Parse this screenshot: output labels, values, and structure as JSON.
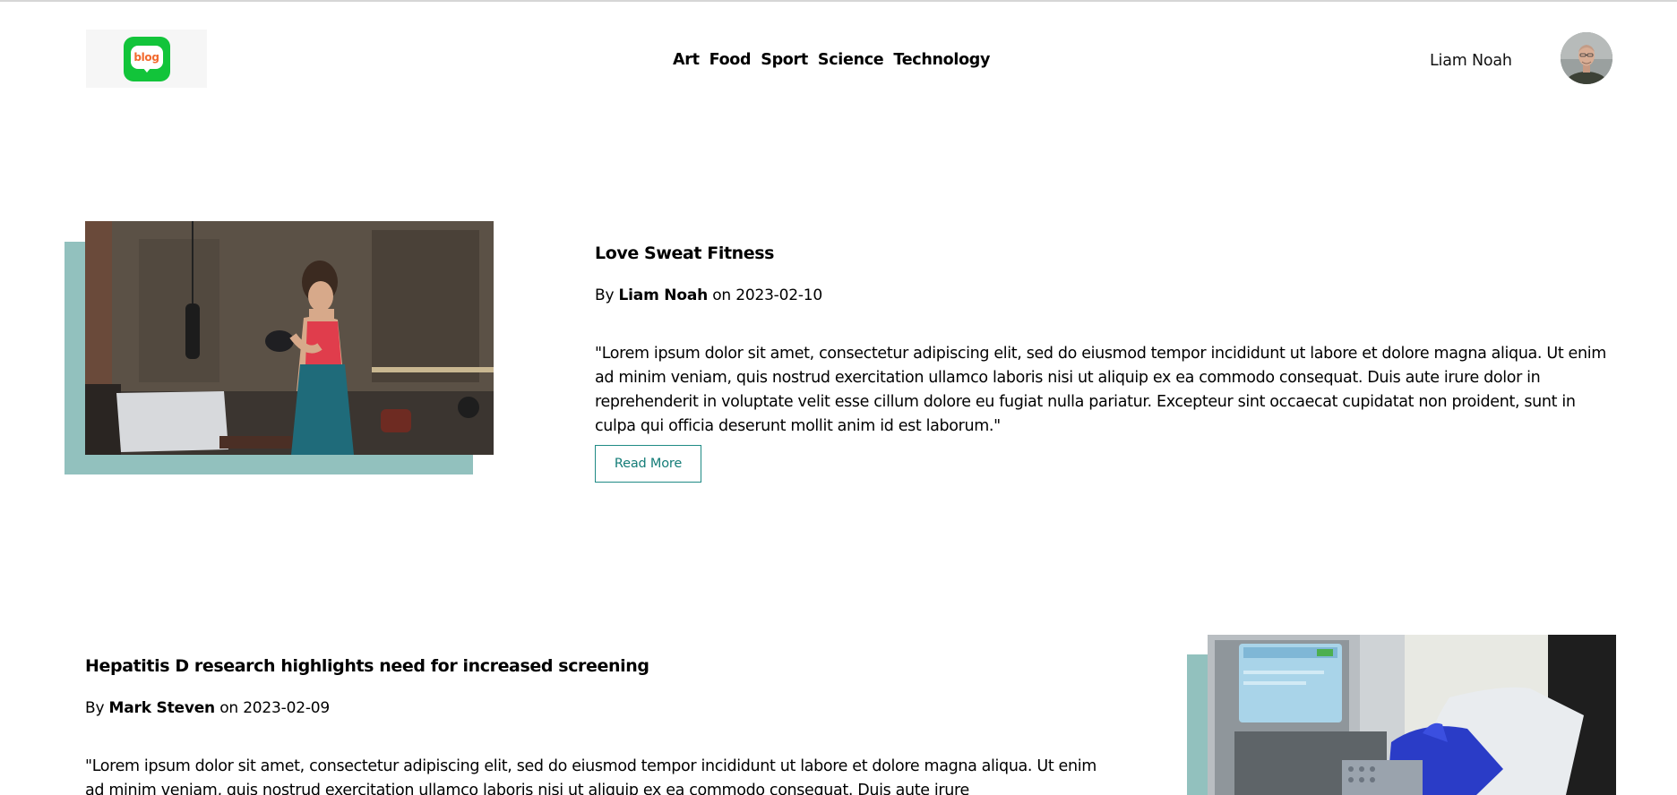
{
  "header": {
    "logo_text": "blog",
    "nav": [
      {
        "label": "Art"
      },
      {
        "label": "Food"
      },
      {
        "label": "Sport"
      },
      {
        "label": "Science"
      },
      {
        "label": "Technology"
      }
    ],
    "user_name": "Liam Noah"
  },
  "articles": [
    {
      "title": "Love Sweat Fitness",
      "by_prefix": "By",
      "author": "Liam Noah",
      "date_prefix": "on",
      "date": "2023-02-10",
      "excerpt": "\"Lorem ipsum dolor sit amet, consectetur adipiscing elit, sed do eiusmod tempor incididunt ut labore et dolore magna aliqua. Ut enim ad minim veniam, quis nostrud exercitation ullamco laboris nisi ut aliquip ex ea commodo consequat. Duis aute irure dolor in reprehenderit in voluptate velit esse cillum dolore eu fugiat nulla pariatur. Excepteur sint occaecat cupidatat non proident, sunt in culpa qui officia deserunt mollit anim id est laborum.\"",
      "read_more": "Read More"
    },
    {
      "title": "Hepatitis D research highlights need for increased screening",
      "by_prefix": "By",
      "author": "Mark Steven",
      "date_prefix": "on",
      "date": "2023-02-09",
      "excerpt": "\"Lorem ipsum dolor sit amet, consectetur adipiscing elit, sed do eiusmod tempor incididunt ut labore et dolore magna aliqua. Ut enim ad minim veniam, quis nostrud exercitation ullamco laboris nisi ut aliquip ex ea commodo consequat. Duis aute irure"
    }
  ],
  "colors": {
    "accent_teal": "#92c1be",
    "button_border": "#1f8a85",
    "logo_green": "#12c43a",
    "logo_text": "#f26a2e"
  },
  "icons": {
    "logo": "blog-chat-bubble-icon",
    "avatar": "user-avatar-photo"
  }
}
